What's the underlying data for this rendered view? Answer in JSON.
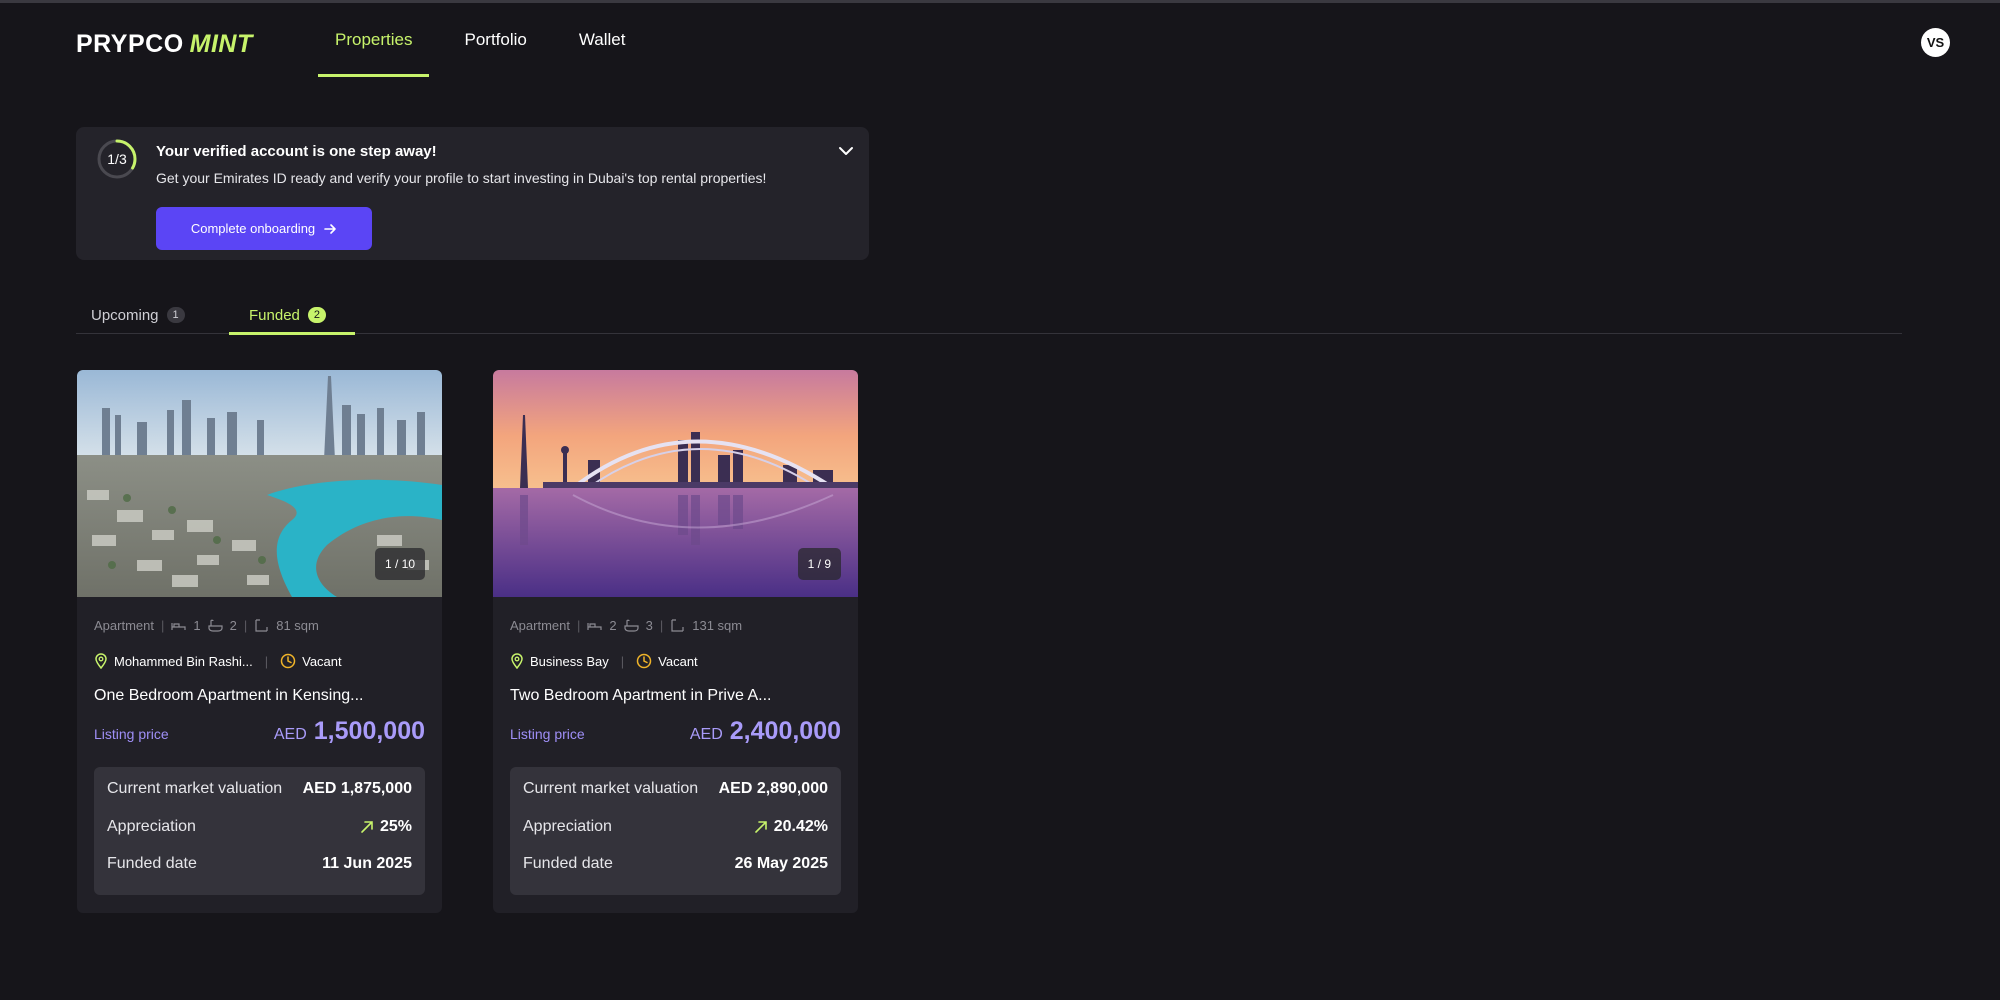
{
  "brand": {
    "part1": "PRYPCO",
    "part2": "MINT",
    "accent": "#c7f36b"
  },
  "nav": {
    "items": [
      {
        "label": "Properties",
        "active": true
      },
      {
        "label": "Portfolio",
        "active": false
      },
      {
        "label": "Wallet",
        "active": false
      }
    ]
  },
  "user": {
    "initials": "VS"
  },
  "onboarding": {
    "progress_text": "1/3",
    "progress_fraction": 0.333,
    "title": "Your verified account is one step away!",
    "description": "Get your Emirates ID ready and verify your profile to start investing in Dubai's top rental properties!",
    "button_label": "Complete onboarding",
    "icons": {
      "toggle": "chevron-down-icon",
      "button": "arrow-right-icon"
    }
  },
  "tabs": [
    {
      "label": "Upcoming",
      "count": "1",
      "active": false
    },
    {
      "label": "Funded",
      "count": "2",
      "active": true
    }
  ],
  "properties": [
    {
      "image_counter": "1 / 10",
      "type": "Apartment",
      "bedrooms": "1",
      "bathrooms": "2",
      "area": "81 sqm",
      "location": "Mohammed Bin Rashi...",
      "status": "Vacant",
      "title": "One Bedroom Apartment in Kensing...",
      "price_label": "Listing price",
      "price_currency": "AED",
      "price_value": "1,500,000",
      "valuation_label": "Current market valuation",
      "valuation_value": "AED 1,875,000",
      "appreciation_label": "Appreciation",
      "appreciation_value": "25%",
      "funded_label": "Funded date",
      "funded_value": "11 Jun 2025"
    },
    {
      "image_counter": "1 / 9",
      "type": "Apartment",
      "bedrooms": "2",
      "bathrooms": "3",
      "area": "131 sqm",
      "location": "Business Bay",
      "status": "Vacant",
      "title": "Two Bedroom Apartment in Prive A...",
      "price_label": "Listing price",
      "price_currency": "AED",
      "price_value": "2,400,000",
      "valuation_label": "Current market valuation",
      "valuation_value": "AED 2,890,000",
      "appreciation_label": "Appreciation",
      "appreciation_value": "20.42%",
      "funded_label": "Funded date",
      "funded_value": "26 May 2025"
    }
  ],
  "colors": {
    "background": "#16151a",
    "card": "#212027",
    "price": "#a99bf9",
    "button": "#5b45f5",
    "status": "#f0b429"
  }
}
